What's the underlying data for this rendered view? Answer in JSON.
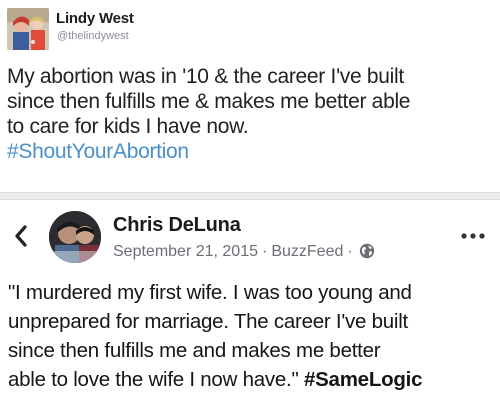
{
  "tweet": {
    "author_name": "Lindy West",
    "author_handle": "@thelindywest",
    "avatar_icon": "profile-photo",
    "body_lines": [
      "My abortion was in '10 & the career I've built",
      "since then fulfills me & makes me better able",
      "to care for kids I have now."
    ],
    "hashtag": "#ShoutYourAbortion",
    "hashtag_color": "#4a90c9"
  },
  "post": {
    "back_icon": "chevron-left-icon",
    "author_name": "Chris DeLuna",
    "avatar_icon": "profile-photo",
    "date": "September 21, 2015",
    "separator": "·",
    "source": "BuzzFeed",
    "audience_icon": "globe-icon",
    "menu_icon": "more-dots-icon",
    "body_lines": [
      "\"I murdered my first wife. I was too young and",
      "unprepared for marriage. The career I've built",
      "since then fulfills me and makes me better",
      "able to love the wife I now have.\""
    ],
    "hashtag": "#SameLogic"
  }
}
